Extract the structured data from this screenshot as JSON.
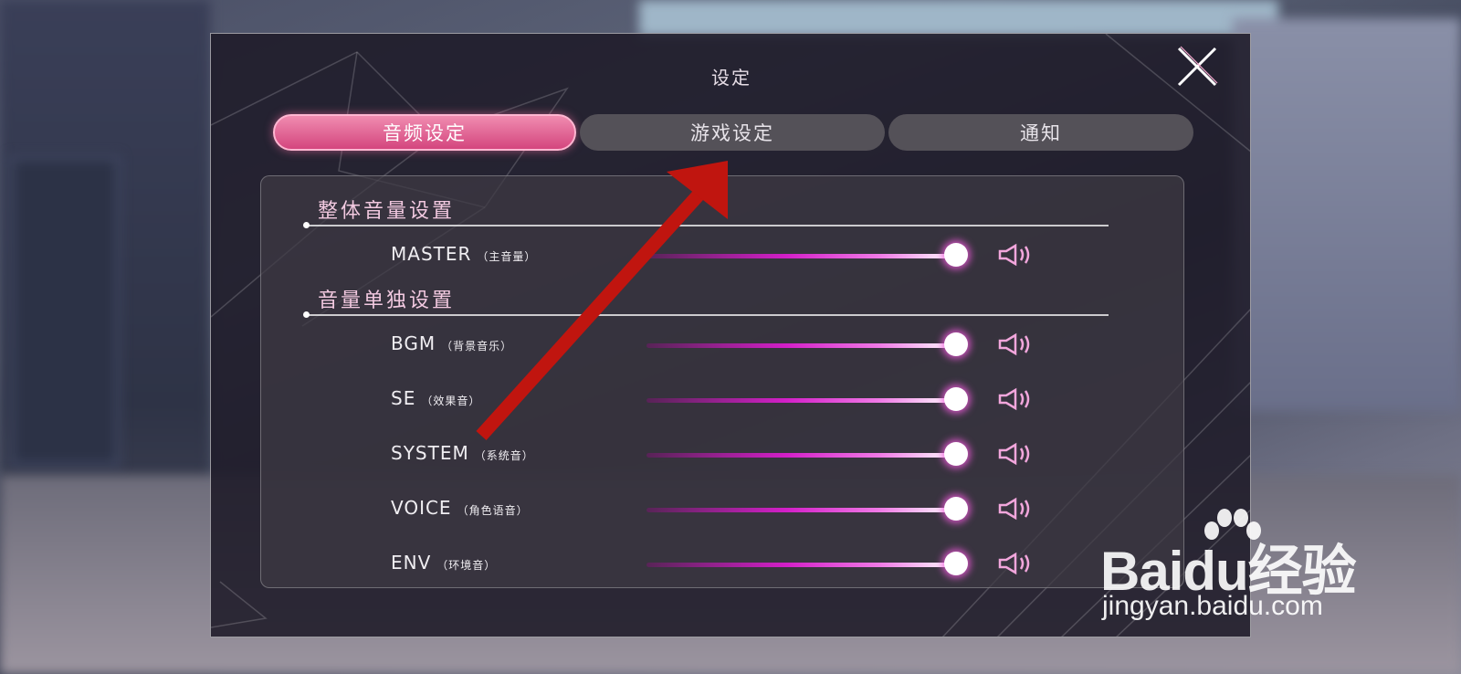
{
  "dialog": {
    "title": "设定",
    "close_icon": "close-icon"
  },
  "tabs": [
    {
      "label": "音频设定",
      "active": true
    },
    {
      "label": "游戏设定",
      "active": false
    },
    {
      "label": "通知",
      "active": false
    }
  ],
  "sections": {
    "overall": {
      "title": "整体音量设置",
      "rows": [
        {
          "label": "MASTER",
          "sub": "（主音量）",
          "value": 1.0
        }
      ]
    },
    "individual": {
      "title": "音量单独设置",
      "rows": [
        {
          "label": "BGM",
          "sub": "（背景音乐）",
          "value": 1.0
        },
        {
          "label": "SE",
          "sub": "（效果音）",
          "value": 1.0
        },
        {
          "label": "SYSTEM",
          "sub": "（系统音）",
          "value": 1.0
        },
        {
          "label": "VOICE",
          "sub": "（角色语音）",
          "value": 1.0
        },
        {
          "label": "ENV",
          "sub": "（环境音）",
          "value": 1.0
        }
      ]
    }
  },
  "icons": {
    "speaker": "speaker-icon"
  },
  "colors": {
    "accent_pink": "#d4457e",
    "slider_magenta": "#d31fc8",
    "arrow_red": "#c0150f"
  },
  "watermark": {
    "brand": "Baidu经验",
    "url": "jingyan.baidu.com"
  }
}
